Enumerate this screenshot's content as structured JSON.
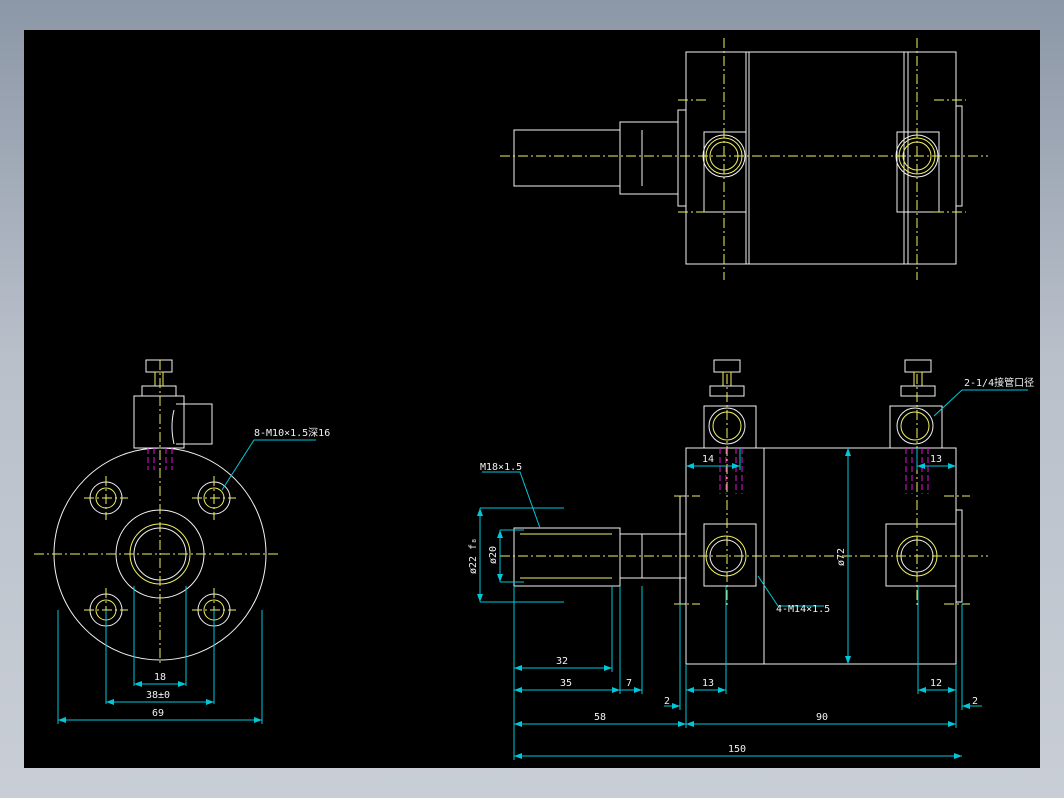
{
  "colors": {
    "background": "#000000",
    "outline": "#f2f2f2",
    "centerline": "#f0f060",
    "dimension": "#00c8d8",
    "hidden_thread": "#e010e0",
    "frame": "#9aa3b0"
  },
  "annotations": {
    "bolt_holes": "8-M10×1.5深16",
    "rod_thread": "M18×1.5",
    "ports": "2-1/4接管口径",
    "mount_holes": "4-M14×1.5",
    "rod_dia_fit": "ø22 f₈",
    "rod_dia": "ø20",
    "bore_dia": "ø72"
  },
  "dimensions": {
    "front_18": "18",
    "front_38": "38±0",
    "front_69": "69",
    "d_14": "14",
    "d_13_top": "13",
    "d_32": "32",
    "d_35": "35",
    "d_7": "7",
    "d_2_left": "2",
    "d_13_bottom": "13",
    "d_12": "12",
    "d_2_right": "2",
    "d_58": "58",
    "d_90": "90",
    "d_150": "150"
  }
}
